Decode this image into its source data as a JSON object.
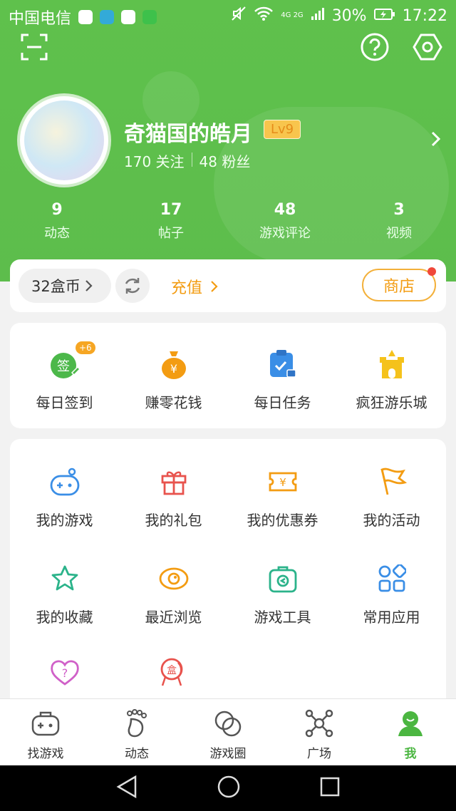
{
  "status": {
    "carrier": "中国电信",
    "battery": "30%",
    "time": "17:22",
    "network": "4G 2G"
  },
  "profile": {
    "name": "奇猫国的皓月",
    "level": "Lv9",
    "following": "170 关注",
    "fans": "48 粉丝"
  },
  "stats": [
    {
      "num": "9",
      "label": "动态"
    },
    {
      "num": "17",
      "label": "帖子"
    },
    {
      "num": "48",
      "label": "游戏评论"
    },
    {
      "num": "3",
      "label": "视频"
    }
  ],
  "coins": {
    "amount": "32盒币",
    "charge": "充值",
    "shop": "商店"
  },
  "quick": [
    {
      "label": "每日签到",
      "badge": "+6",
      "icon": "sign-in-icon"
    },
    {
      "label": "赚零花钱",
      "icon": "money-bag-icon"
    },
    {
      "label": "每日任务",
      "icon": "task-clipboard-icon"
    },
    {
      "label": "疯狂游乐城",
      "icon": "castle-icon"
    }
  ],
  "menu": [
    {
      "label": "我的游戏",
      "icon": "gamepad-icon",
      "color": "#3a8ee6"
    },
    {
      "label": "我的礼包",
      "icon": "gift-icon",
      "color": "#e8534d"
    },
    {
      "label": "我的优惠券",
      "icon": "coupon-icon",
      "color": "#f39c12"
    },
    {
      "label": "我的活动",
      "icon": "flag-icon",
      "color": "#f39c12"
    },
    {
      "label": "我的收藏",
      "icon": "star-icon",
      "color": "#2bb38a"
    },
    {
      "label": "最近浏览",
      "icon": "eye-icon",
      "color": "#f39c12"
    },
    {
      "label": "游戏工具",
      "icon": "toolbox-icon",
      "color": "#2bb38a"
    },
    {
      "label": "常用应用",
      "icon": "apps-grid-icon",
      "color": "#3a8ee6"
    },
    {
      "label": "",
      "icon": "help-heart-icon",
      "color": "#d060c8"
    },
    {
      "label": "",
      "icon": "medal-icon",
      "color": "#e8534d"
    }
  ],
  "nav": [
    {
      "label": "找游戏",
      "icon": "gamepad-nav-icon"
    },
    {
      "label": "动态",
      "icon": "footprint-icon"
    },
    {
      "label": "游戏圈",
      "icon": "circles-icon"
    },
    {
      "label": "广场",
      "icon": "network-icon"
    },
    {
      "label": "我",
      "icon": "user-icon",
      "active": true
    }
  ],
  "colors": {
    "primary": "#5fc14c",
    "accent": "#f39c12",
    "active": "#4bb641"
  }
}
